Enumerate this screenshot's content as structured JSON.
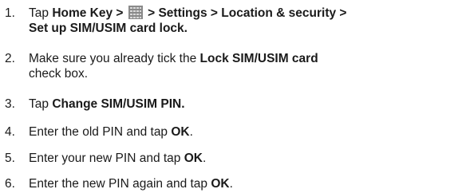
{
  "steps": [
    {
      "num": "1.",
      "parts": {
        "a": "Tap ",
        "b": "Home Key > ",
        "c": " > Settings > Location & security >",
        "d": "Set up SIM/USIM card lock."
      },
      "icon": "menu-grid-icon"
    },
    {
      "num": "2.",
      "parts": {
        "a": "Make sure you already tick the ",
        "b": "Lock SIM/USIM card",
        "c": "check box."
      }
    },
    {
      "num": "3.",
      "parts": {
        "a": "Tap ",
        "b": "Change SIM/USIM PIN."
      }
    },
    {
      "num": "4.",
      "parts": {
        "a": "Enter the old PIN and tap ",
        "b": "OK",
        "c": "."
      }
    },
    {
      "num": "5.",
      "parts": {
        "a": "Enter your new PIN and tap ",
        "b": "OK",
        "c": "."
      }
    },
    {
      "num": "6.",
      "parts": {
        "a": "Enter the new PIN again and tap ",
        "b": "OK",
        "c": "."
      }
    }
  ],
  "colors": {
    "text": "#1a1a1a",
    "icon_fill": "#8a8a8a",
    "icon_cell": "#d9d9d9"
  }
}
